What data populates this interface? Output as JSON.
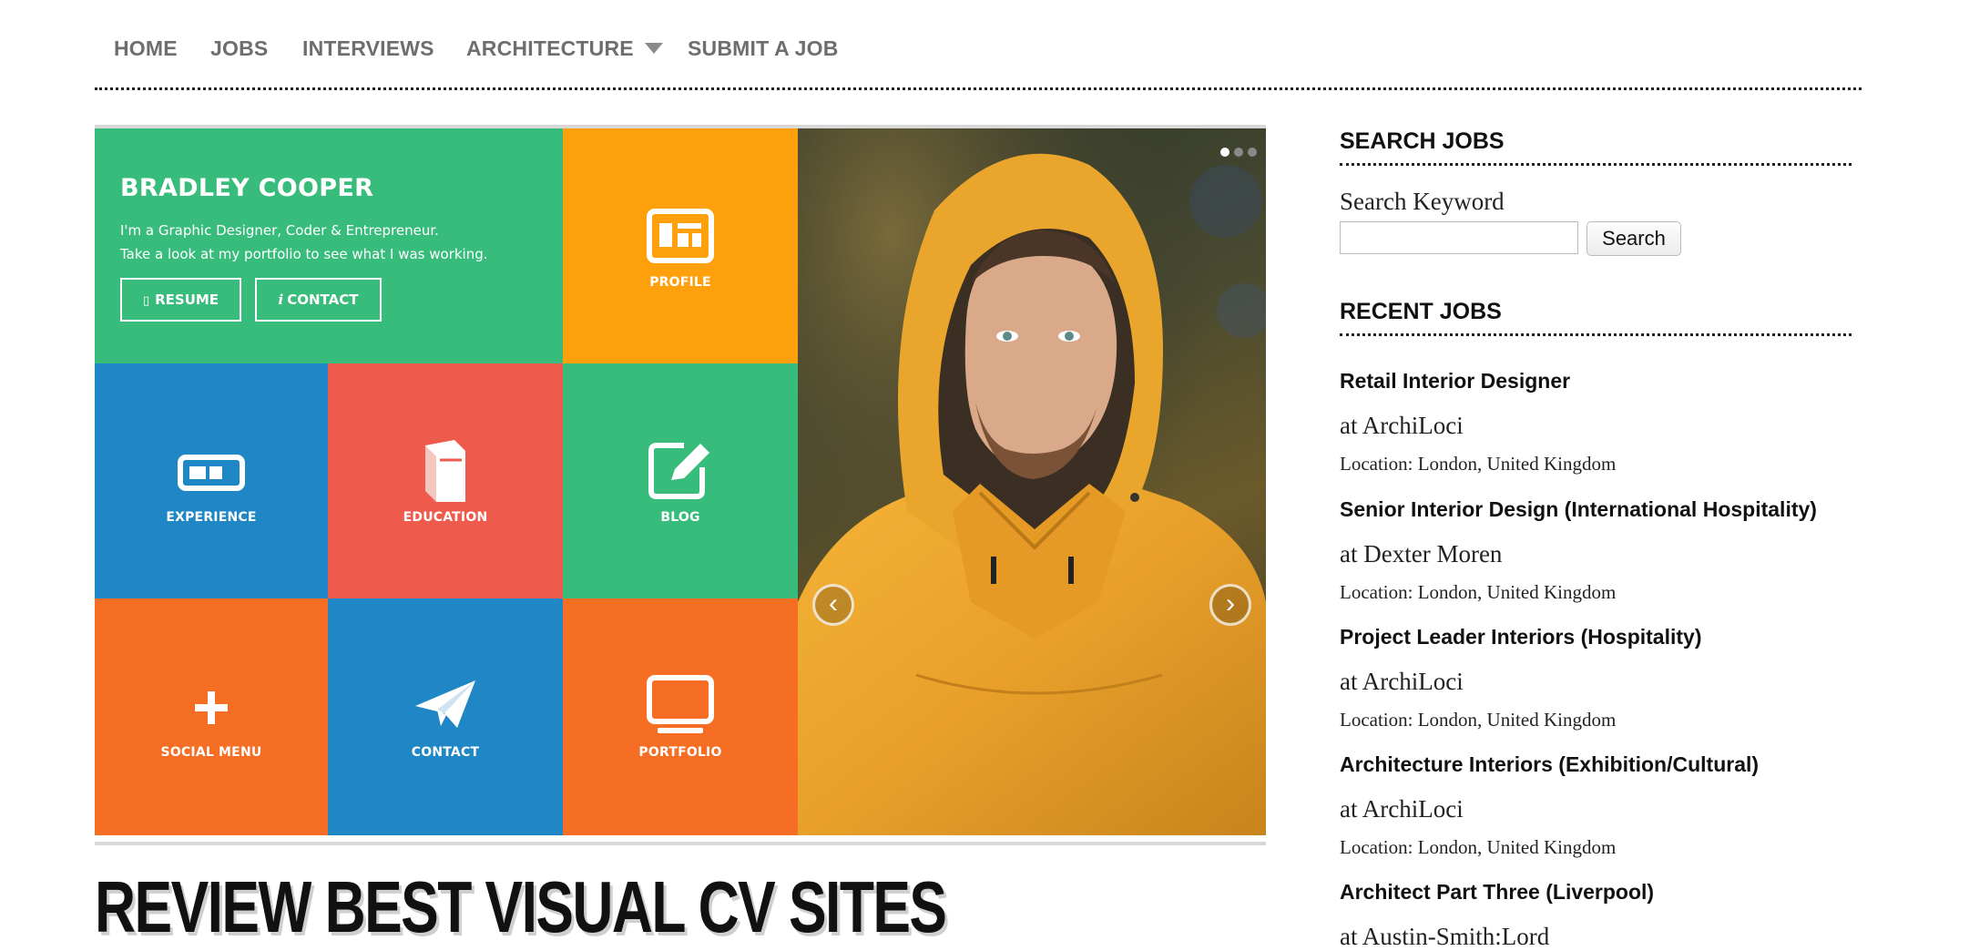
{
  "nav": {
    "items": [
      "HOME",
      "JOBS",
      "INTERVIEWS",
      "ARCHITECTURE",
      "SUBMIT A JOB"
    ]
  },
  "hero": {
    "name": "BRADLEY COOPER",
    "intro_line1": "I'm a Graphic Designer, Coder & Entrepreneur.",
    "intro_line2": "Take a look at my portfolio to see what I was working.",
    "resume_label": "RESUME",
    "contact_btn_label": "CONTACT",
    "tiles": {
      "profile": "PROFILE",
      "experience": "EXPERIENCE",
      "education": "EDUCATION",
      "blog": "BLOG",
      "social": "SOCIAL MENU",
      "contact": "CONTACT",
      "portfolio": "PORTFOLIO"
    },
    "colors": {
      "green": "#37bc7b",
      "orange_yellow": "#fea00c",
      "blue": "#1f87c5",
      "red": "#ee5a4b",
      "orange": "#f56e23"
    },
    "prev_icon": "chevron-left-icon",
    "next_icon": "chevron-right-icon",
    "slide_count": 3
  },
  "headline": "REVIEW BEST VISUAL CV SITES",
  "sidebar": {
    "search_heading": "SEARCH JOBS",
    "search_label": "Search Keyword",
    "search_value": "",
    "search_button": "Search",
    "recent_heading": "RECENT JOBS",
    "jobs": [
      {
        "title": "Retail Interior Designer",
        "company": "at ArchiLoci",
        "location": "Location: London, United Kingdom"
      },
      {
        "title": "Senior Interior Design (International Hospitality)",
        "company": "at Dexter Moren",
        "location": "Location: London, United Kingdom"
      },
      {
        "title": "Project Leader Interiors (Hospitality)",
        "company": "at ArchiLoci",
        "location": "Location: London, United Kingdom"
      },
      {
        "title": "Architecture Interiors (Exhibition/Cultural)",
        "company": "at ArchiLoci",
        "location": "Location: London, United Kingdom"
      },
      {
        "title": "Architect Part Three (Liverpool)",
        "company": "at Austin-Smith:Lord",
        "location": ""
      }
    ]
  }
}
